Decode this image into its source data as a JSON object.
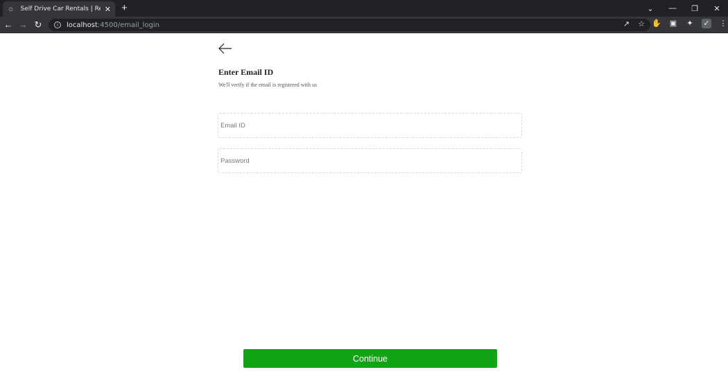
{
  "browser": {
    "tab_title": "Self Drive Car Rentals | Rent a Car",
    "url_host": "localhost",
    "url_path": ":4500/email_login"
  },
  "page": {
    "title": "Enter Email ID",
    "subtitle": "We'll verify if the email is registered with us",
    "email_placeholder": "Email ID",
    "password_placeholder": "Password",
    "continue_label": "Continue"
  },
  "colors": {
    "primary_button": "#13a416"
  }
}
